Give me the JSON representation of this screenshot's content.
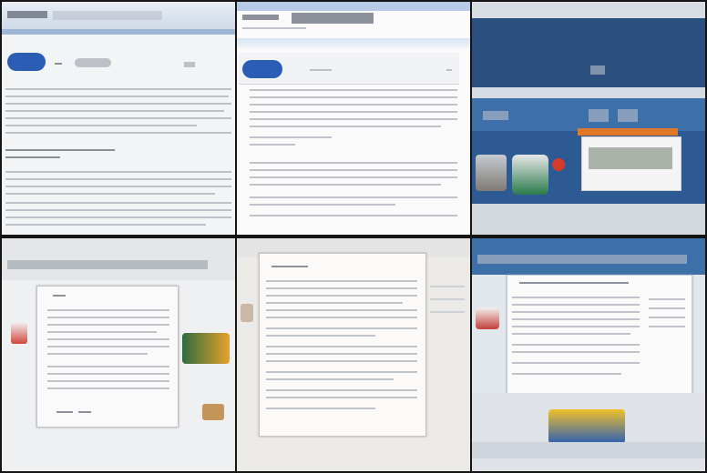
{
  "grid": {
    "rows": 2,
    "columns": 3
  },
  "tiles": [
    {
      "id": "tile-1",
      "theme": "light-article"
    },
    {
      "id": "tile-2",
      "theme": "light-article"
    },
    {
      "id": "tile-3",
      "theme": "blue-storefront"
    },
    {
      "id": "tile-4",
      "theme": "gray-dialog"
    },
    {
      "id": "tile-5",
      "theme": "paper-dialog"
    },
    {
      "id": "tile-6",
      "theme": "blue-dialog"
    }
  ],
  "colors": {
    "page_bg": "#151515",
    "blue_header": "#3d6fa8",
    "dark_blue": "#2a4e7d",
    "logo_blue": "#2c5db4",
    "orange": "#e07a2a",
    "red": "#d33b2f",
    "yellow": "#f0c02a",
    "text_gray": "#8f96a0"
  }
}
